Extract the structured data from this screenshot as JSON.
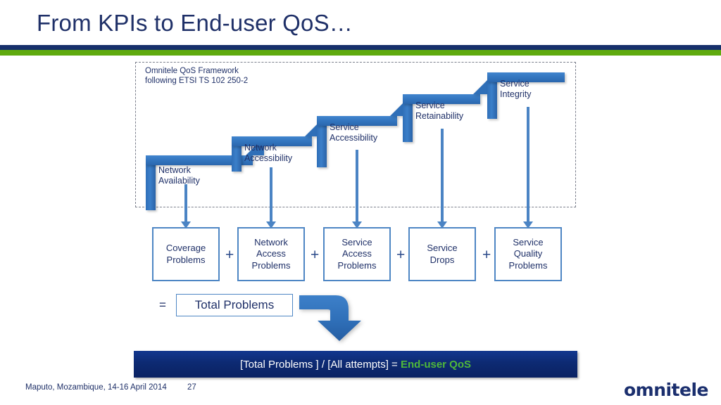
{
  "slide": {
    "title": "From KPIs to End-user QoS…",
    "accent_navy": "#16306b",
    "accent_green": "#5faa0f",
    "text_navy": "#1f3068",
    "bar_blue": "#2f6fb8"
  },
  "framework": {
    "caption": "Omnitele QoS Framework\nfollowing ETSI TS 102 250-2",
    "steps": [
      {
        "label": "Network\nAvailability"
      },
      {
        "label": "Network\nAccessibility"
      },
      {
        "label": "Service\nAccessibility"
      },
      {
        "label": "Service\nRetainability"
      },
      {
        "label": "Service\nIntegrity"
      }
    ]
  },
  "problems": {
    "boxes": [
      {
        "label": "Coverage\nProblems"
      },
      {
        "label": "Network\nAccess\nProblems"
      },
      {
        "label": "Service\nAccess\nProblems"
      },
      {
        "label": "Service\nDrops"
      },
      {
        "label": "Service\nQuality\nProblems"
      }
    ],
    "operator": "+",
    "equals": "=",
    "total_label": "Total Problems"
  },
  "result_banner": {
    "formula": "[Total Problems ] / [All attempts] = ",
    "metric": "End-user QoS",
    "metric_color": "#4fb83a"
  },
  "footer": {
    "event": "Maputo, Mozambique, 14-16 April 2014",
    "slide_number": "27",
    "logo": "omnitele"
  }
}
